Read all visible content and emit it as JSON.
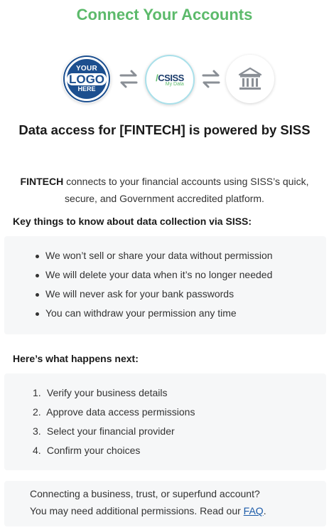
{
  "header": {
    "title": "Connect Your Accounts"
  },
  "logos": {
    "your_logo": {
      "line1": "YOUR",
      "line2": "LOGO",
      "line3": "HERE"
    },
    "siss": {
      "brand": "CSISS",
      "tagline": "My Data"
    },
    "bank_icon": "bank-icon"
  },
  "main": {
    "heading": "Data access for [FINTECH] is powered by SISS",
    "intro_bold": "FINTECH",
    "intro_rest": " connects to your financial accounts using SISS’s quick, secure, and Government accredited platform."
  },
  "key_things": {
    "title": "Key things to know about data collection via SISS:",
    "items": [
      "We won’t sell or share your data without permission",
      "We will delete your data when it’s no longer needed",
      "We will never ask for your bank passwords",
      "You can withdraw your permission any time"
    ]
  },
  "next_steps": {
    "title": "Here’s what happens next:",
    "items": [
      {
        "num": "1.",
        "text": "Verify your business details"
      },
      {
        "num": "2.",
        "text": "Approve data access permissions"
      },
      {
        "num": "3.",
        "text": "Select your financial provider"
      },
      {
        "num": "4.",
        "text": "Confirm your choices"
      }
    ]
  },
  "notice": {
    "line1": "Connecting a business, trust, or superfund account?",
    "line2_pre": "You may need additional permissions. Read our ",
    "link": "FAQ",
    "line2_post": "."
  },
  "colors": {
    "accent": "#5cba6b",
    "brand_blue": "#1c4f8f",
    "link": "#1a5aa8"
  }
}
